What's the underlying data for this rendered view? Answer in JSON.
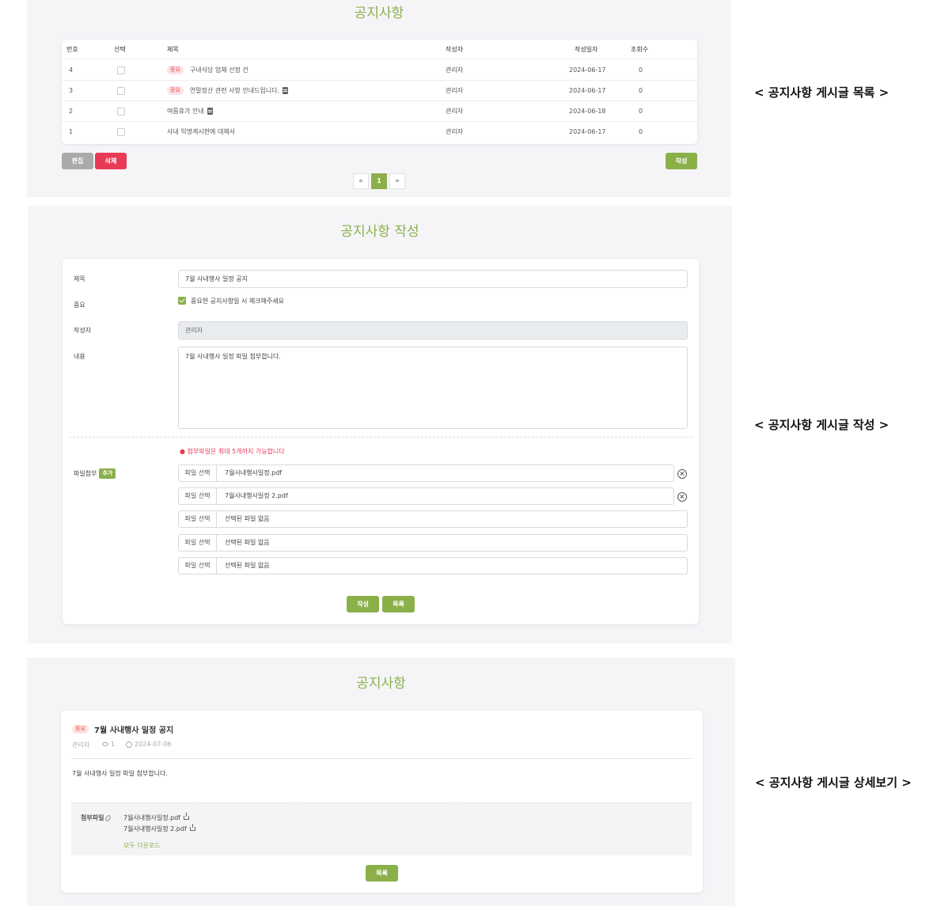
{
  "list_page": {
    "title": "공지사항",
    "caption": "< 공지사항 게시글 목록 >",
    "columns": [
      "번호",
      "선택",
      "제목",
      "작성자",
      "작성일자",
      "조회수"
    ],
    "rows": [
      {
        "no": "4",
        "badge": "중요",
        "title": "구내식당 업체 선정 건",
        "attach": false,
        "author": "관리자",
        "date": "2024-06-17",
        "views": "0"
      },
      {
        "no": "3",
        "badge": "중요",
        "title": "연말정산 관련 사항 안내드립니다.",
        "attach": true,
        "author": "관리자",
        "date": "2024-06-17",
        "views": "0"
      },
      {
        "no": "2",
        "badge": "",
        "title": "여름휴가 안내",
        "attach": true,
        "author": "관리자",
        "date": "2024-06-18",
        "views": "0"
      },
      {
        "no": "1",
        "badge": "",
        "title": "사내 익명게시판에 대해서",
        "attach": false,
        "author": "관리자",
        "date": "2024-06-17",
        "views": "0"
      }
    ],
    "buttons": {
      "edit": "편집",
      "delete": "삭제",
      "write": "작성"
    },
    "pager": {
      "prev": "«",
      "current": "1",
      "next": "»"
    }
  },
  "write_page": {
    "title": "공지사항 작성",
    "caption": "< 공지사항 게시글 작성 >",
    "labels": {
      "subject": "제목",
      "important": "중요",
      "author": "작성자",
      "content": "내용",
      "attach": "파일첨부",
      "add": "추가"
    },
    "subject_value": "7월 사내행사 일정 공지",
    "important_text": "중요한 공지사항일 시 체크해주세요",
    "author_value": "관리자",
    "content_value": "7월 사내행사 일정 파일 첨부합니다.",
    "attach_notice": "● 첨부파일은 최대 5개까지 가능합니다",
    "file_button": "파일 선택",
    "files": [
      "7월사내행사일정.pdf",
      "7월사내행사일정 2.pdf",
      "선택된 파일 없음",
      "선택된 파일 없음",
      "선택된 파일 없음"
    ],
    "buttons": {
      "submit": "작성",
      "list": "목록"
    }
  },
  "detail_page": {
    "title": "공지사항",
    "caption": "< 공지사항 게시글 상세보기 >",
    "badge": "중요",
    "post_title": "7월 사내행사 일정 공지",
    "author": "관리자",
    "views": "1",
    "date": "2024-07-06",
    "body": "7월 사내행사 일정 파일 첨부합니다.",
    "attach_label": "첨부파일",
    "files": [
      "7월사내행사일정.pdf",
      "7월사내행사일정 2.pdf"
    ],
    "download_all": "모두 다운로드",
    "list_button": "목록"
  },
  "colors": {
    "accent": "#8bb04a",
    "danger": "#e83a57",
    "panel": "#f5f5f8"
  }
}
